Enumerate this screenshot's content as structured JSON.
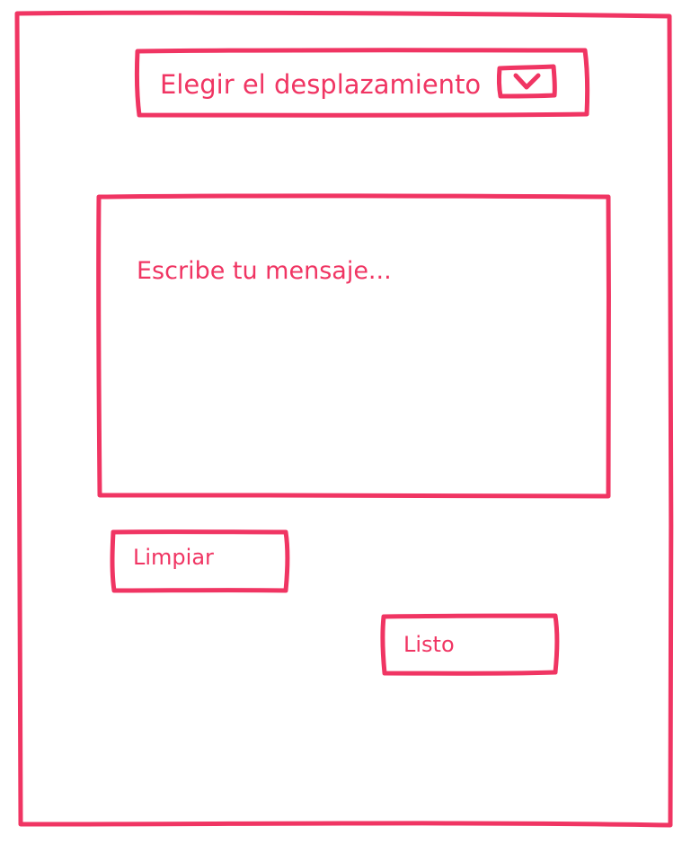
{
  "form": {
    "dropdown": {
      "label": "Elegir el desplazamiento",
      "toggle_icon": "chevron-down-icon"
    },
    "message": {
      "placeholder": "Escribe tu mensaje..."
    },
    "clear_button": {
      "label": "Limpiar"
    },
    "done_button": {
      "label": "Listo"
    }
  },
  "theme": {
    "accent": "#f03563",
    "background": "#ffffff"
  }
}
